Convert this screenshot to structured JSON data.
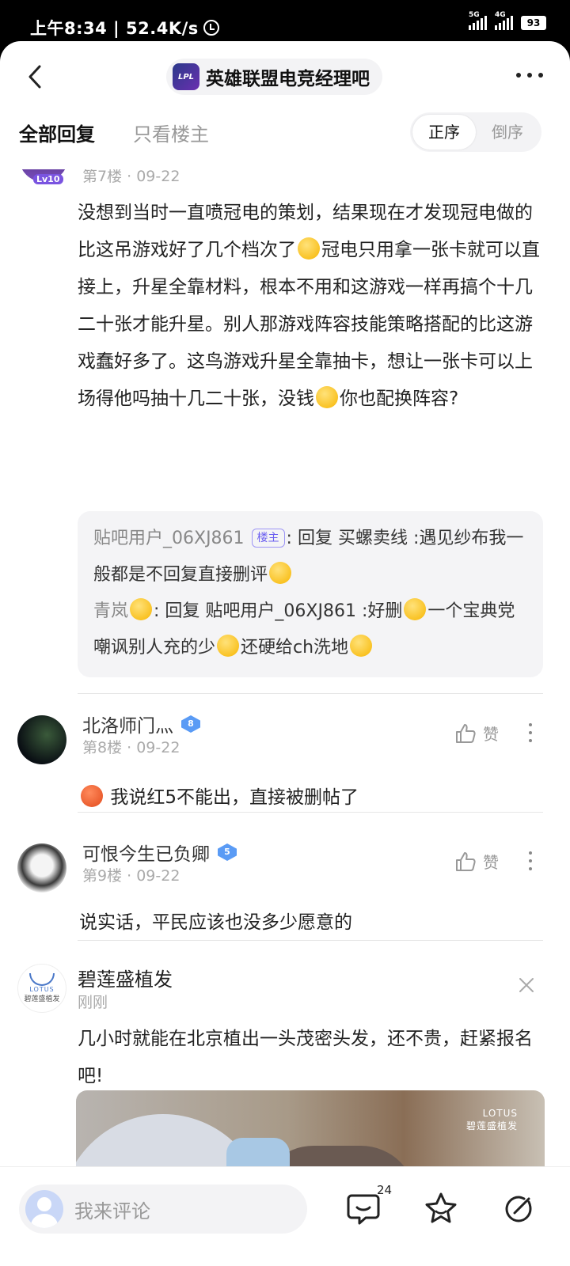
{
  "status_bar": {
    "time_speed": "上午8:34 | 52.4K/s",
    "battery": "93",
    "net1": "5G",
    "net2": "4G"
  },
  "nav": {
    "forum_name": "英雄联盟电竞经理吧",
    "forum_logo_text": "LPL"
  },
  "tabs": {
    "all": "全部回复",
    "op_only": "只看楼主",
    "asc": "正序",
    "desc": "倒序"
  },
  "post7": {
    "meta": "第7楼 · 09-22",
    "level": "Lv10",
    "content_1": "没想到当时一直喷冠电的策划，结果现在才发现冠电做的比这吊游戏好了几个档次了",
    "content_2": "冠电只用拿一张卡就可以直接上，升星全靠材料，根本不用和这游戏一样再搞个十几二十张才能升星。别人那游戏阵容技能策略搭配的比这游戏蠢好多了。这鸟游戏升星全靠抽卡，想让一张卡可以上场得他吗抽十几二十张，没钱",
    "content_3": "你也配换阵容?",
    "replies": [
      {
        "name": "贴吧用户_06XJ861",
        "tag": "楼主",
        "prefix": ": 回复 ",
        "target": "买螺卖线",
        "text": " :遇见纱布我一般都是不回复直接删评"
      },
      {
        "name": "青岚",
        "prefix": ": 回复 ",
        "target": "贴吧用户_06XJ861",
        "text": " :好删",
        "text2": "一个宝典党嘲讽别人充的少",
        "text3": "还硬给ch洗地"
      }
    ]
  },
  "comments": [
    {
      "name": "北洛师门灬",
      "level": "8",
      "meta": "第8楼 · 09-22",
      "like": "赞",
      "text": "我说红5不能出，直接被删帖了"
    },
    {
      "name": "可恨今生已负卿",
      "level": "5",
      "meta": "第9楼 · 09-22",
      "like": "赞",
      "text": "说实话，平民应该也没多少愿意的"
    }
  ],
  "ad": {
    "name": "碧莲盛植发",
    "time": "刚刚",
    "text": "几小时就能在北京植出一头茂密头发，还不贵，赶紧报名吧!",
    "logo_en": "LOTUS",
    "logo_cn": "碧莲盛植发"
  },
  "bottom": {
    "placeholder": "我来评论",
    "comment_count": "24"
  },
  "colors": {
    "accent": "#6b5ff0",
    "level_badge": "#5a9bf5"
  }
}
